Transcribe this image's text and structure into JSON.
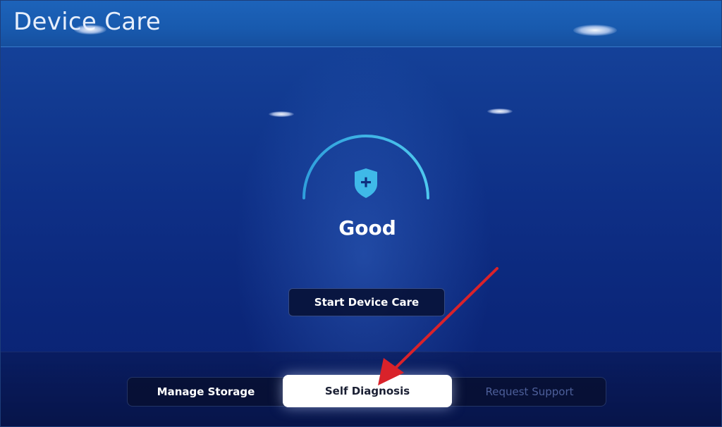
{
  "app": {
    "title": "Device Care"
  },
  "status": {
    "label": "Good"
  },
  "actions": {
    "start_label": "Start Device Care"
  },
  "tabs": [
    {
      "label": "Manage Storage",
      "state": "normal"
    },
    {
      "label": "Self Diagnosis",
      "state": "focused"
    },
    {
      "label": "Request Support",
      "state": "dimmed"
    }
  ],
  "icons": {
    "shield": "shield-plus-icon"
  },
  "colors": {
    "accent": "#3fb9e8",
    "arrow": "#d9222a",
    "background": "#0e2f86",
    "focused_tab": "#ffffff"
  }
}
